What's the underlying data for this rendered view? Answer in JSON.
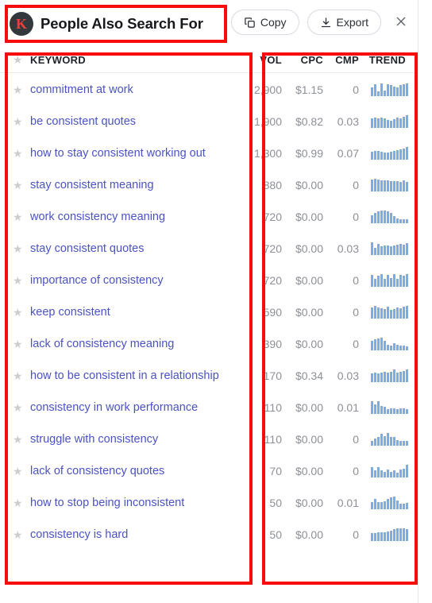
{
  "header": {
    "logo_letter": "K",
    "title": "People Also Search For",
    "copy_label": "Copy",
    "export_label": "Export",
    "copy_icon": "copy-icon",
    "export_icon": "download-icon",
    "close_icon": "close-icon"
  },
  "table": {
    "columns": {
      "keyword": "KEYWORD",
      "vol": "VOL",
      "cpc": "CPC",
      "cmp": "CMP",
      "trend": "TREND"
    },
    "rows": [
      {
        "keyword": "commitment at work",
        "vol": "2,900",
        "cpc": "$1.15",
        "cmp": "0",
        "trend": [
          10,
          14,
          6,
          15,
          7,
          14,
          13,
          11,
          10,
          13,
          14,
          15
        ]
      },
      {
        "keyword": "be consistent quotes",
        "vol": "1,900",
        "cpc": "$0.82",
        "cmp": "0.03",
        "trend": [
          11,
          12,
          11,
          12,
          11,
          9,
          8,
          10,
          12,
          11,
          13,
          15
        ]
      },
      {
        "keyword": "how to stay consistent working out",
        "vol": "1,300",
        "cpc": "$0.99",
        "cmp": "0.07",
        "trend": [
          9,
          10,
          10,
          9,
          8,
          8,
          9,
          10,
          11,
          12,
          13,
          15
        ]
      },
      {
        "keyword": "stay consistent meaning",
        "vol": "880",
        "cpc": "$0.00",
        "cmp": "0",
        "trend": [
          14,
          15,
          14,
          13,
          13,
          13,
          12,
          12,
          12,
          11,
          13,
          11
        ]
      },
      {
        "keyword": "work consistency meaning",
        "vol": "720",
        "cpc": "$0.00",
        "cmp": "0",
        "trend": [
          9,
          12,
          14,
          15,
          15,
          14,
          12,
          8,
          6,
          5,
          5,
          5
        ]
      },
      {
        "keyword": "stay consistent quotes",
        "vol": "720",
        "cpc": "$0.00",
        "cmp": "0.03",
        "trend": [
          15,
          8,
          13,
          10,
          11,
          11,
          10,
          11,
          12,
          13,
          12,
          14
        ]
      },
      {
        "keyword": "importance of consistency",
        "vol": "720",
        "cpc": "$0.00",
        "cmp": "0",
        "trend": [
          14,
          9,
          13,
          15,
          9,
          14,
          10,
          15,
          9,
          14,
          13,
          15
        ]
      },
      {
        "keyword": "keep consistent",
        "vol": "590",
        "cpc": "$0.00",
        "cmp": "0",
        "trend": [
          13,
          15,
          13,
          12,
          11,
          14,
          10,
          11,
          13,
          12,
          14,
          15
        ]
      },
      {
        "keyword": "lack of consistency meaning",
        "vol": "390",
        "cpc": "$0.00",
        "cmp": "0",
        "trend": [
          11,
          13,
          14,
          15,
          11,
          7,
          6,
          8,
          7,
          6,
          6,
          5
        ]
      },
      {
        "keyword": "how to be consistent in a relationship",
        "vol": "170",
        "cpc": "$0.34",
        "cmp": "0.03",
        "trend": [
          10,
          11,
          10,
          11,
          12,
          11,
          12,
          15,
          11,
          12,
          13,
          15
        ]
      },
      {
        "keyword": "consistency in work performance",
        "vol": "110",
        "cpc": "$0.00",
        "cmp": "0.01",
        "trend": [
          15,
          11,
          15,
          9,
          8,
          6,
          7,
          7,
          6,
          7,
          7,
          6
        ]
      },
      {
        "keyword": "struggle with consistency",
        "vol": "110",
        "cpc": "$0.00",
        "cmp": "0",
        "trend": [
          5,
          7,
          9,
          12,
          10,
          13,
          9,
          9,
          6,
          5,
          5,
          5
        ]
      },
      {
        "keyword": "lack of consistency quotes",
        "vol": "70",
        "cpc": "$0.00",
        "cmp": "0",
        "trend": [
          12,
          8,
          12,
          8,
          7,
          9,
          7,
          8,
          6,
          9,
          10,
          15
        ]
      },
      {
        "keyword": "how to stop being inconsistent",
        "vol": "50",
        "cpc": "$0.00",
        "cmp": "0.01",
        "trend": [
          8,
          11,
          8,
          8,
          9,
          11,
          13,
          14,
          10,
          6,
          6,
          7
        ]
      },
      {
        "keyword": "consistency is hard",
        "vol": "50",
        "cpc": "$0.00",
        "cmp": "0",
        "trend": [
          9,
          9,
          10,
          10,
          10,
          11,
          12,
          14,
          15,
          15,
          15,
          14
        ]
      }
    ]
  },
  "colors": {
    "keyword_link": "#4b52c4",
    "spark_bar": "#7aace6",
    "annotation": "#f60c0c",
    "logo_bg": "#33383d",
    "logo_letter": "#e8413a"
  }
}
